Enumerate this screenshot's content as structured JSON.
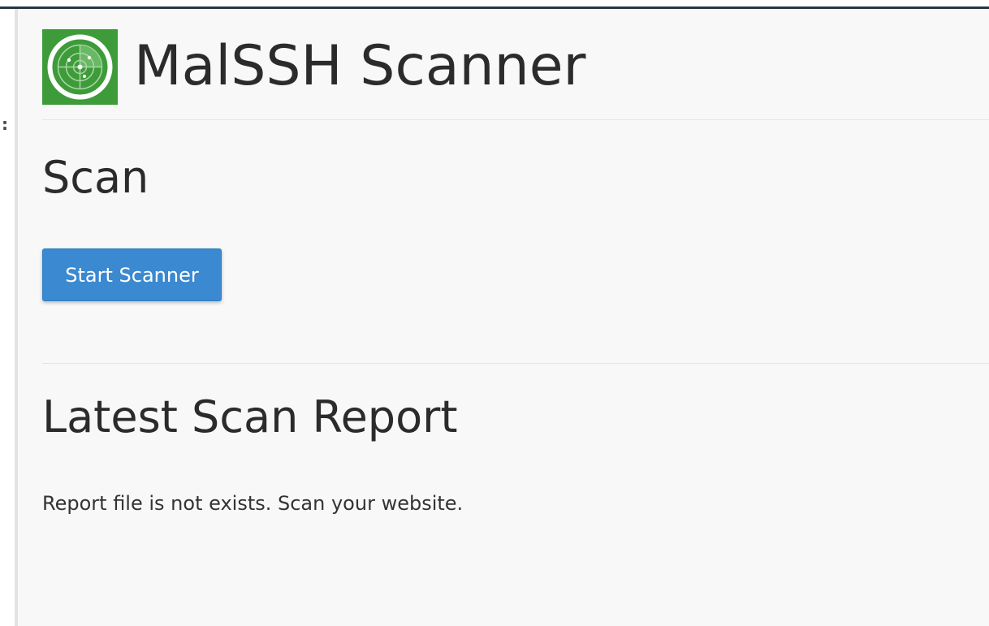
{
  "header": {
    "title": "MalSSH Scanner",
    "logo_icon": "radar-icon",
    "logo_color": "#3e9b3a"
  },
  "scan": {
    "title": "Scan",
    "start_button_label": "Start Scanner",
    "button_color": "#3a89d1"
  },
  "report": {
    "title": "Latest Scan Report",
    "message": "Report file is not exists. Scan your website."
  }
}
